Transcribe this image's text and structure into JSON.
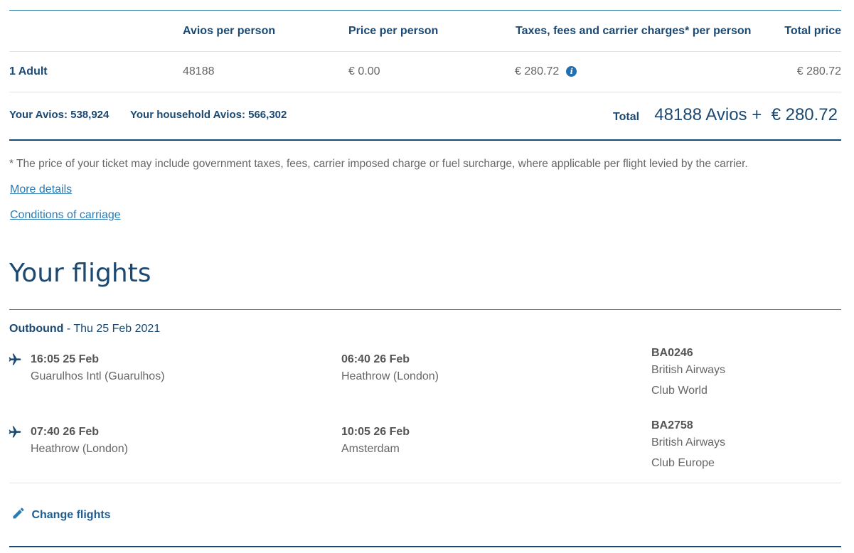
{
  "price_table": {
    "headers": [
      "Avios per person",
      "Price per person",
      "Taxes, fees and carrier charges* per person",
      "Total price"
    ],
    "row": {
      "passenger": "1 Adult",
      "avios": "48188",
      "price": "€ 0.00",
      "taxes": "€ 280.72",
      "total": "€ 280.72"
    }
  },
  "summary": {
    "your_avios_label": "Your Avios:",
    "your_avios_value": "538,924",
    "household_label": "Your household Avios:",
    "household_value": "566,302",
    "total_label": "Total",
    "total_value": "48188 Avios +  € 280.72"
  },
  "disclaimer": "* The price of your ticket may include government taxes, fees, carrier imposed charge or fuel surcharge, where applicable per flight levied by the carrier.",
  "links": {
    "more_details": "More details",
    "conditions": "Conditions of carriage"
  },
  "flights_section": {
    "title": "Your flights",
    "direction": "Outbound",
    "date": " - Thu 25 Feb 2021",
    "segments": [
      {
        "depart_time": "16:05 25 Feb",
        "depart_place": "Guarulhos Intl (Guarulhos)",
        "arrive_time": "06:40 26 Feb",
        "arrive_place": "Heathrow (London)",
        "flight_no": "BA0246",
        "airline": "British Airways",
        "cabin": "Club World"
      },
      {
        "depart_time": "07:40 26 Feb",
        "depart_place": "Heathrow (London)",
        "arrive_time": "10:05 26 Feb",
        "arrive_place": "Amsterdam",
        "flight_no": "BA2758",
        "airline": "British Airways",
        "cabin": "Club Europe"
      }
    ],
    "change_label": "Change flights"
  },
  "colors": {
    "navy": "#1b4972",
    "link": "#2a7bb3",
    "rule_teal": "#3b86a8",
    "rule_dark": "#1b4972"
  },
  "icons": [
    "info-icon",
    "plane-icon",
    "pencil-icon"
  ]
}
